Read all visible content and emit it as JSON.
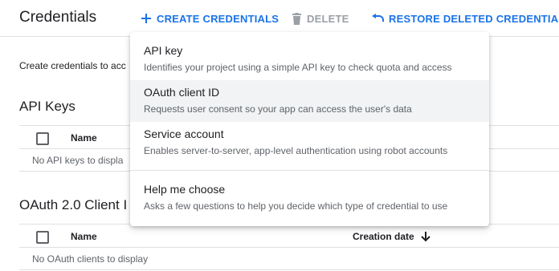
{
  "header": {
    "title": "Credentials",
    "create_label": "CREATE CREDENTIALS",
    "delete_label": "DELETE",
    "restore_label": "RESTORE DELETED CREDENTIALS"
  },
  "main": {
    "intro_text": "Create credentials to acc",
    "api_keys": {
      "title": "API Keys",
      "columns": {
        "name": "Name"
      },
      "empty_text": "No API keys to displa"
    },
    "oauth": {
      "title": "OAuth 2.0 Client I",
      "columns": {
        "name": "Name",
        "creation_date": "Creation date"
      },
      "empty_text": "No OAuth clients to display"
    }
  },
  "menu": {
    "items": [
      {
        "title": "API key",
        "description": "Identifies your project using a simple API key to check quota and access"
      },
      {
        "title": "OAuth client ID",
        "description": "Requests user consent so your app can access the user's data"
      },
      {
        "title": "Service account",
        "description": "Enables server-to-server, app-level authentication using robot accounts"
      },
      {
        "title": "Help me choose",
        "description": "Asks a few questions to help you decide which type of credential to use"
      }
    ],
    "highlighted_item": "OAuth client ID"
  },
  "icons": {
    "create": "plus-icon",
    "delete": "trash-icon",
    "restore": "undo-icon",
    "sort": "arrow-down-icon"
  },
  "colors": {
    "accent": "#1a73e8",
    "disabled": "#9aa0a6",
    "text": "#202124",
    "secondary_text": "#5f6368",
    "hover": "#f1f3f4"
  }
}
